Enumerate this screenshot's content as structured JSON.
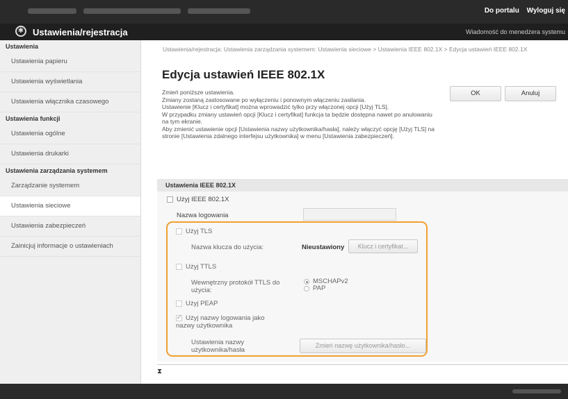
{
  "header": {
    "portal_link": "Do portalu",
    "logout_link": "Wyloguj się",
    "app_title": "Ustawienia/rejestracja",
    "admin_message": "Wiadomość do menedżera systemu"
  },
  "sidebar": {
    "sections": [
      {
        "title": "Ustawienia",
        "items": [
          "Ustawienia papieru",
          "Ustawienia wyświetlania",
          "Ustawienia włącznika czasowego"
        ]
      },
      {
        "title": "Ustawienia funkcji",
        "items": [
          "Ustawienia ogólne",
          "Ustawienia drukarki"
        ]
      },
      {
        "title": "Ustawienia zarządzania systemem",
        "items": [
          "Zarządzanie systemem",
          "Ustawienia sieciowe",
          "Ustawienia zabezpieczeń",
          "Zainicjuj informacje o ustawieniach"
        ]
      }
    ],
    "active_item": "Ustawienia sieciowe"
  },
  "main": {
    "breadcrumb": "Ustawienia/rejestracja: Ustawienia zarządzania systemem: Ustawienia sieciowe > Ustawienia IEEE 802.1X > Edycja ustawień IEEE 802.1X",
    "title": "Edycja ustawień IEEE 802.1X",
    "description": [
      "Zmień poniższe ustawienia.",
      "Zmiany zostaną zastosowane po wyłączeniu i ponownym włączeniu zasilania.",
      "Ustawienie [Klucz i certyfikat] można wprowadzić tylko przy włączonej opcji [Użyj TLS].",
      "W przypadku zmiany ustawień opcji [Klucz i certyfikat] funkcja ta będzie dostępna nawet po anulowaniu na tym ekranie.",
      "Aby zmienić ustawienie opcji [Ustawienia nazwy użytkownika/hasła], należy włączyć opcję [Użyj TLS] na stronie [Ustawienia zdalnego interfejsu użytkownika] w menu [Ustawienia zabezpieczeń]."
    ],
    "ok_label": "OK",
    "cancel_label": "Anuluj",
    "section_title": "Ustawienia IEEE 802.1X",
    "use_ieee_label": "Użyj IEEE 802.1X",
    "login_name_label": "Nazwa logowania",
    "login_name_value": "",
    "use_tls_label": "Użyj TLS",
    "key_label": "Nazwa klucza do użycia:",
    "key_value": "Nieustawiony",
    "key_button": "Klucz i certyfikat...",
    "use_ttls_label": "Użyj TTLS",
    "ttls_protocol_label_1": "Wewnętrzny protokół TTLS do",
    "ttls_protocol_label_2": "użycia:",
    "protocol_options": [
      "MSCHAPv2",
      "PAP"
    ],
    "selected_protocol": "MSCHAPv2",
    "use_peap_label": "Użyj PEAP",
    "use_username_label_1": "Użyj nazwy logowania jako",
    "use_username_label_2": "nazwy użytkownika",
    "username_settings_label_1": "Ustawienia nazwy",
    "username_settings_label_2": "użytkownika/hasła",
    "change_username_button": "Zmień nazwę użytkownika/hasło..."
  }
}
